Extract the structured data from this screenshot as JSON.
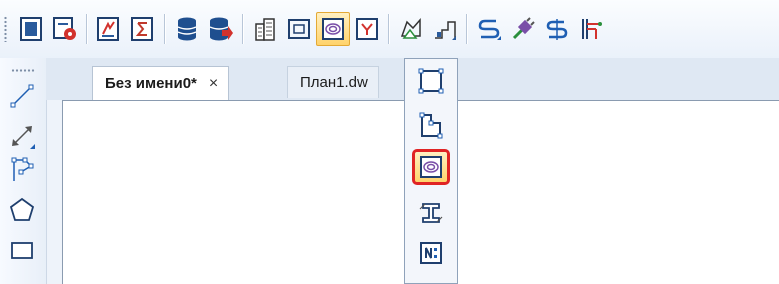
{
  "toolbar": {
    "buttons": [
      {
        "icon": "document-icon"
      },
      {
        "icon": "document-settings-icon"
      },
      {
        "icon": "text-edit-icon"
      },
      {
        "icon": "sigma-table-icon"
      },
      {
        "icon": "database-icon"
      },
      {
        "icon": "database-export-icon"
      },
      {
        "icon": "building-icon"
      },
      {
        "icon": "room-outline-icon"
      },
      {
        "icon": "zone-icon",
        "active": true
      },
      {
        "icon": "opening-icon"
      },
      {
        "icon": "area-label-icon"
      },
      {
        "icon": "stamp-icon"
      },
      {
        "icon": "pipe-s-icon"
      },
      {
        "icon": "plug-icon"
      },
      {
        "icon": "dollar-s-icon"
      },
      {
        "icon": "column-beam-icon"
      }
    ]
  },
  "left_toolbar": {
    "tools": [
      "line-icon",
      "dimension-arrow-icon",
      "polyline-icon",
      "polygon-icon",
      "rectangle-icon"
    ]
  },
  "tabs": [
    {
      "label": "Без имени0*",
      "active": true,
      "close": "×"
    },
    {
      "label": "План1.dw",
      "active": false
    }
  ],
  "flyout": {
    "items": [
      {
        "icon": "rectangle-room-icon"
      },
      {
        "icon": "stepped-room-icon"
      },
      {
        "icon": "zone-ellipse-icon",
        "highlighted": true
      },
      {
        "icon": "i-beam-section-icon"
      },
      {
        "icon": "numbered-room-icon"
      }
    ]
  },
  "colors": {
    "toolbar_bg": "#eaf1fa",
    "active_fill": "#ffd36b",
    "highlight_border": "#e02424",
    "icon_blue": "#1f5fb3",
    "icon_red": "#d2322d"
  }
}
